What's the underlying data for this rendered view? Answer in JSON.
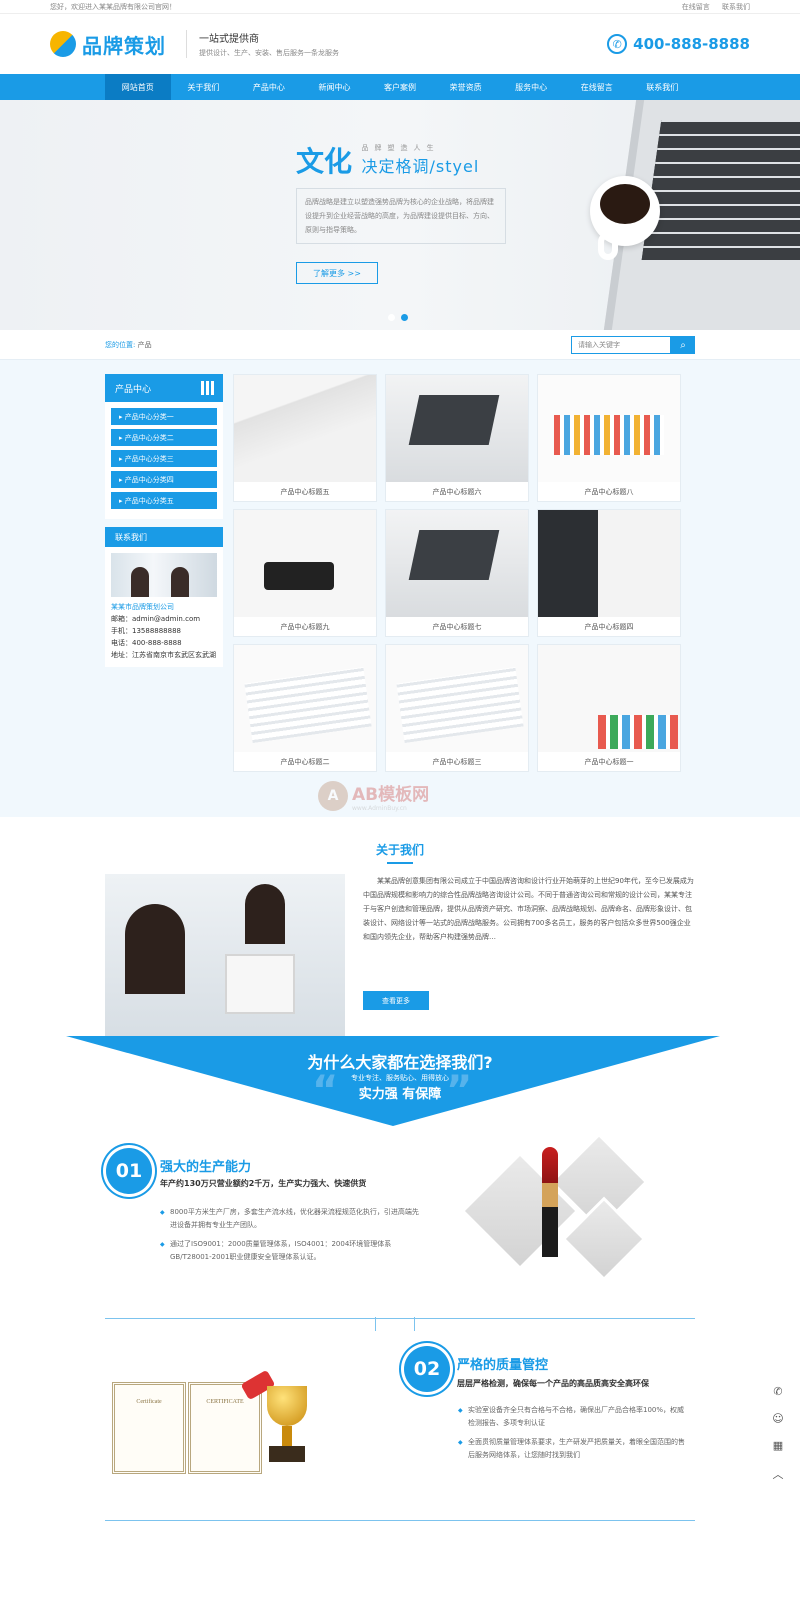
{
  "topbar": {
    "welcome": "您好，欢迎进入某某品牌有限公司官网！",
    "links": [
      "在线留言",
      "联系我们"
    ]
  },
  "header": {
    "logo_text": "品牌策划",
    "slogan_main": "一站式提供商",
    "slogan_sub": "提供设计、生产、安装、售后服务一条龙服务",
    "hotline": "400-888-8888"
  },
  "nav": {
    "items": [
      "网站首页",
      "关于我们",
      "产品中心",
      "新闻中心",
      "客户案例",
      "荣誉资质",
      "服务中心",
      "在线留言",
      "联系我们"
    ]
  },
  "banner": {
    "big": "文化",
    "small": "品牌塑造人生",
    "sub": "决定格调/styel",
    "desc": "品牌战略是建立以塑造强势品牌为核心的企业战略，将品牌建设提升到企业经营战略的高度，为品牌建设提供目标、方向、原则与指导策略。",
    "more": "了解更多 >>",
    "active_slide": 2
  },
  "breadcrumb": {
    "label": "您的位置:",
    "path": "产品"
  },
  "search": {
    "placeholder": "请输入关键字"
  },
  "sidebar": {
    "title": "产品中心",
    "categories": [
      "产品中心分类一",
      "产品中心分类二",
      "产品中心分类三",
      "产品中心分类四",
      "产品中心分类五"
    ],
    "contact_title": "联系我们",
    "company": "某某市品牌策划公司",
    "email": "邮箱：admin@admin.com",
    "mobile": "手机：13588888888",
    "phone": "电话：400-888-8888",
    "address": "地址：江苏省南京市玄武区玄武湖"
  },
  "products": [
    "产品中心标题五",
    "产品中心标题六",
    "产品中心标题八",
    "产品中心标题九",
    "产品中心标题七",
    "产品中心标题四",
    "产品中心标题二",
    "产品中心标题三",
    "产品中心标题一"
  ],
  "watermark": {
    "mark": "A",
    "name": "AB模板网",
    "url": "www.AdminBuy.cn"
  },
  "about": {
    "title": "关于我们",
    "text": "某某品牌创意集团有限公司成立于中国品牌咨询和设计行业开始萌芽的上世纪90年代，至今已发展成为中国品牌规模和影响力的综合性品牌战略咨询设计公司。不同于普通咨询公司和常规的设计公司，某某专注于与客户创造和管理品牌，提供从品牌资产研究、市场洞察、品牌战略规划、品牌命名、品牌形象设计、包装设计、网络设计等一站式的品牌战略服务。公司拥有700多名员工，服务的客户包括众多世界500强企业和国内领先企业，帮助客户构建强势品牌…",
    "more": "查看更多"
  },
  "why": {
    "title": "为什么大家都在选择我们?",
    "tags": "专业专注、服务贴心、用得放心",
    "sub": "实力强 有保障",
    "quote_open": "“",
    "quote_close": "”"
  },
  "features": [
    {
      "num": "01",
      "title": "强大的生产能力",
      "sub": "年产约130万只营业额约2千万，生产实力强大、快速供货",
      "points": [
        "8000平方米生产厂房，多套生产流水线，优化器采流程规范化执行，引进高端先进设备并拥有专业生产团队。",
        "通过了ISO9001：2000质量管理体系，ISO4001：2004环境管理体系GB/T28001-2001职业健康安全管理体系认证。"
      ]
    },
    {
      "num": "02",
      "title": "严格的质量管控",
      "sub": "层层严格检测，确保每一个产品的高品质高安全高环保",
      "points": [
        "实验室设备齐全只有合格与不合格，确保出厂产品合格率100%，权威检测报告、多项专利认证",
        "全面贯彻质量管理体系要求，生产研发严把质量关，着眼全国范围的售后服务网络体系，让您随时找到我们"
      ]
    }
  ],
  "certs": [
    "Certificate",
    "CERTIFICATE"
  ],
  "float_bar": [
    "phone-icon",
    "chat-icon",
    "qrcode-icon",
    "top-icon"
  ],
  "colors": {
    "accent": "#1a9be6",
    "accent_dark": "#0b7cc4"
  }
}
